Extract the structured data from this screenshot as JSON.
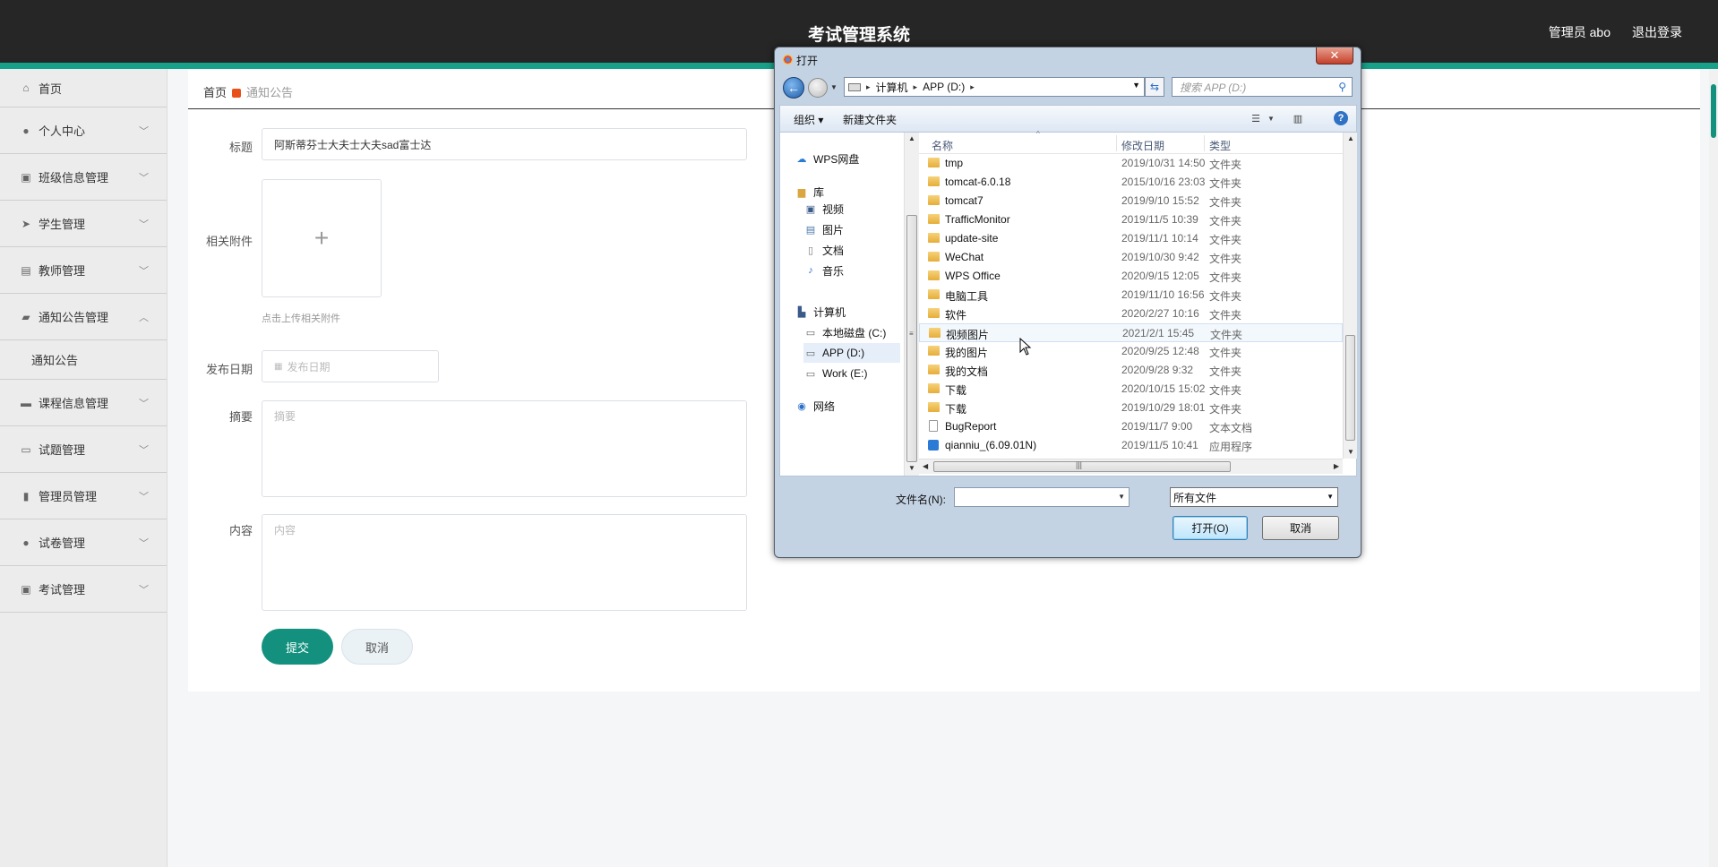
{
  "header": {
    "title": "考试管理系统",
    "user": "管理员 abo",
    "logout": "退出登录"
  },
  "sidebar": {
    "items": [
      {
        "label": "首页",
        "icon": "home-icon"
      },
      {
        "label": "个人中心",
        "icon": "user-icon"
      },
      {
        "label": "班级信息管理",
        "icon": "clipboard-icon"
      },
      {
        "label": "学生管理",
        "icon": "paper-plane-icon"
      },
      {
        "label": "教师管理",
        "icon": "chart-icon"
      },
      {
        "label": "通知公告管理",
        "icon": "comment-icon"
      },
      {
        "label": "课程信息管理",
        "icon": "briefcase-icon"
      },
      {
        "label": "试题管理",
        "icon": "chat-icon"
      },
      {
        "label": "管理员管理",
        "icon": "bar-chart-icon"
      },
      {
        "label": "试卷管理",
        "icon": "user-icon"
      },
      {
        "label": "考试管理",
        "icon": "clipboard-icon"
      }
    ],
    "sub_item": "通知公告"
  },
  "breadcrumb": {
    "home": "首页",
    "current": "通知公告"
  },
  "form": {
    "title_label": "标题",
    "title_value": "阿斯蒂芬士大夫士大夫sad富士达",
    "attach_label": "相关附件",
    "attach_hint": "点击上传相关附件",
    "date_label": "发布日期",
    "date_placeholder": "发布日期",
    "summary_label": "摘要",
    "summary_placeholder": "摘要",
    "content_label": "内容",
    "content_placeholder": "内容",
    "submit": "提交",
    "cancel": "取消"
  },
  "dialog": {
    "title": "打开",
    "close": "✕",
    "path": [
      "计算机",
      "APP (D:)"
    ],
    "search_placeholder": "搜索 APP (D:)",
    "toolbar": {
      "organize": "组织 ▾",
      "new_folder": "新建文件夹"
    },
    "tree": [
      "WPS网盘",
      "库",
      "视频",
      "图片",
      "文档",
      "音乐",
      "计算机",
      "本地磁盘 (C:)",
      "APP (D:)",
      "Work (E:)",
      "网络"
    ],
    "columns": {
      "name": "名称",
      "date": "修改日期",
      "type": "类型"
    },
    "files": [
      {
        "name": "tmp",
        "date": "2019/10/31 14:50",
        "type": "文件夹",
        "kind": "folder"
      },
      {
        "name": "tomcat-6.0.18",
        "date": "2015/10/16 23:03",
        "type": "文件夹",
        "kind": "folder"
      },
      {
        "name": "tomcat7",
        "date": "2019/9/10 15:52",
        "type": "文件夹",
        "kind": "folder"
      },
      {
        "name": "TrafficMonitor",
        "date": "2019/11/5 10:39",
        "type": "文件夹",
        "kind": "folder"
      },
      {
        "name": "update-site",
        "date": "2019/11/1 10:14",
        "type": "文件夹",
        "kind": "folder"
      },
      {
        "name": "WeChat",
        "date": "2019/10/30 9:42",
        "type": "文件夹",
        "kind": "folder"
      },
      {
        "name": "WPS Office",
        "date": "2020/9/15 12:05",
        "type": "文件夹",
        "kind": "folder"
      },
      {
        "name": "电脑工具",
        "date": "2019/11/10 16:56",
        "type": "文件夹",
        "kind": "folder"
      },
      {
        "name": "软件",
        "date": "2020/2/27 10:16",
        "type": "文件夹",
        "kind": "folder"
      },
      {
        "name": "视频图片",
        "date": "2021/2/1 15:45",
        "type": "文件夹",
        "kind": "folder"
      },
      {
        "name": "我的图片",
        "date": "2020/9/25 12:48",
        "type": "文件夹",
        "kind": "folder"
      },
      {
        "name": "我的文档",
        "date": "2020/9/28 9:32",
        "type": "文件夹",
        "kind": "folder"
      },
      {
        "name": "下载",
        "date": "2020/10/15 15:02",
        "type": "文件夹",
        "kind": "folder"
      },
      {
        "name": "下载",
        "date": "2019/10/29 18:01",
        "type": "文件夹",
        "kind": "folder"
      },
      {
        "name": "BugReport",
        "date": "2019/11/7 9:00",
        "type": "文本文档",
        "kind": "doc"
      },
      {
        "name": "qianniu_(6.09.01N)",
        "date": "2019/11/5 10:41",
        "type": "应用程序",
        "kind": "app"
      }
    ],
    "filename_label": "文件名(N):",
    "filetype": "所有文件",
    "open": "打开(O)",
    "cancel": "取消"
  }
}
